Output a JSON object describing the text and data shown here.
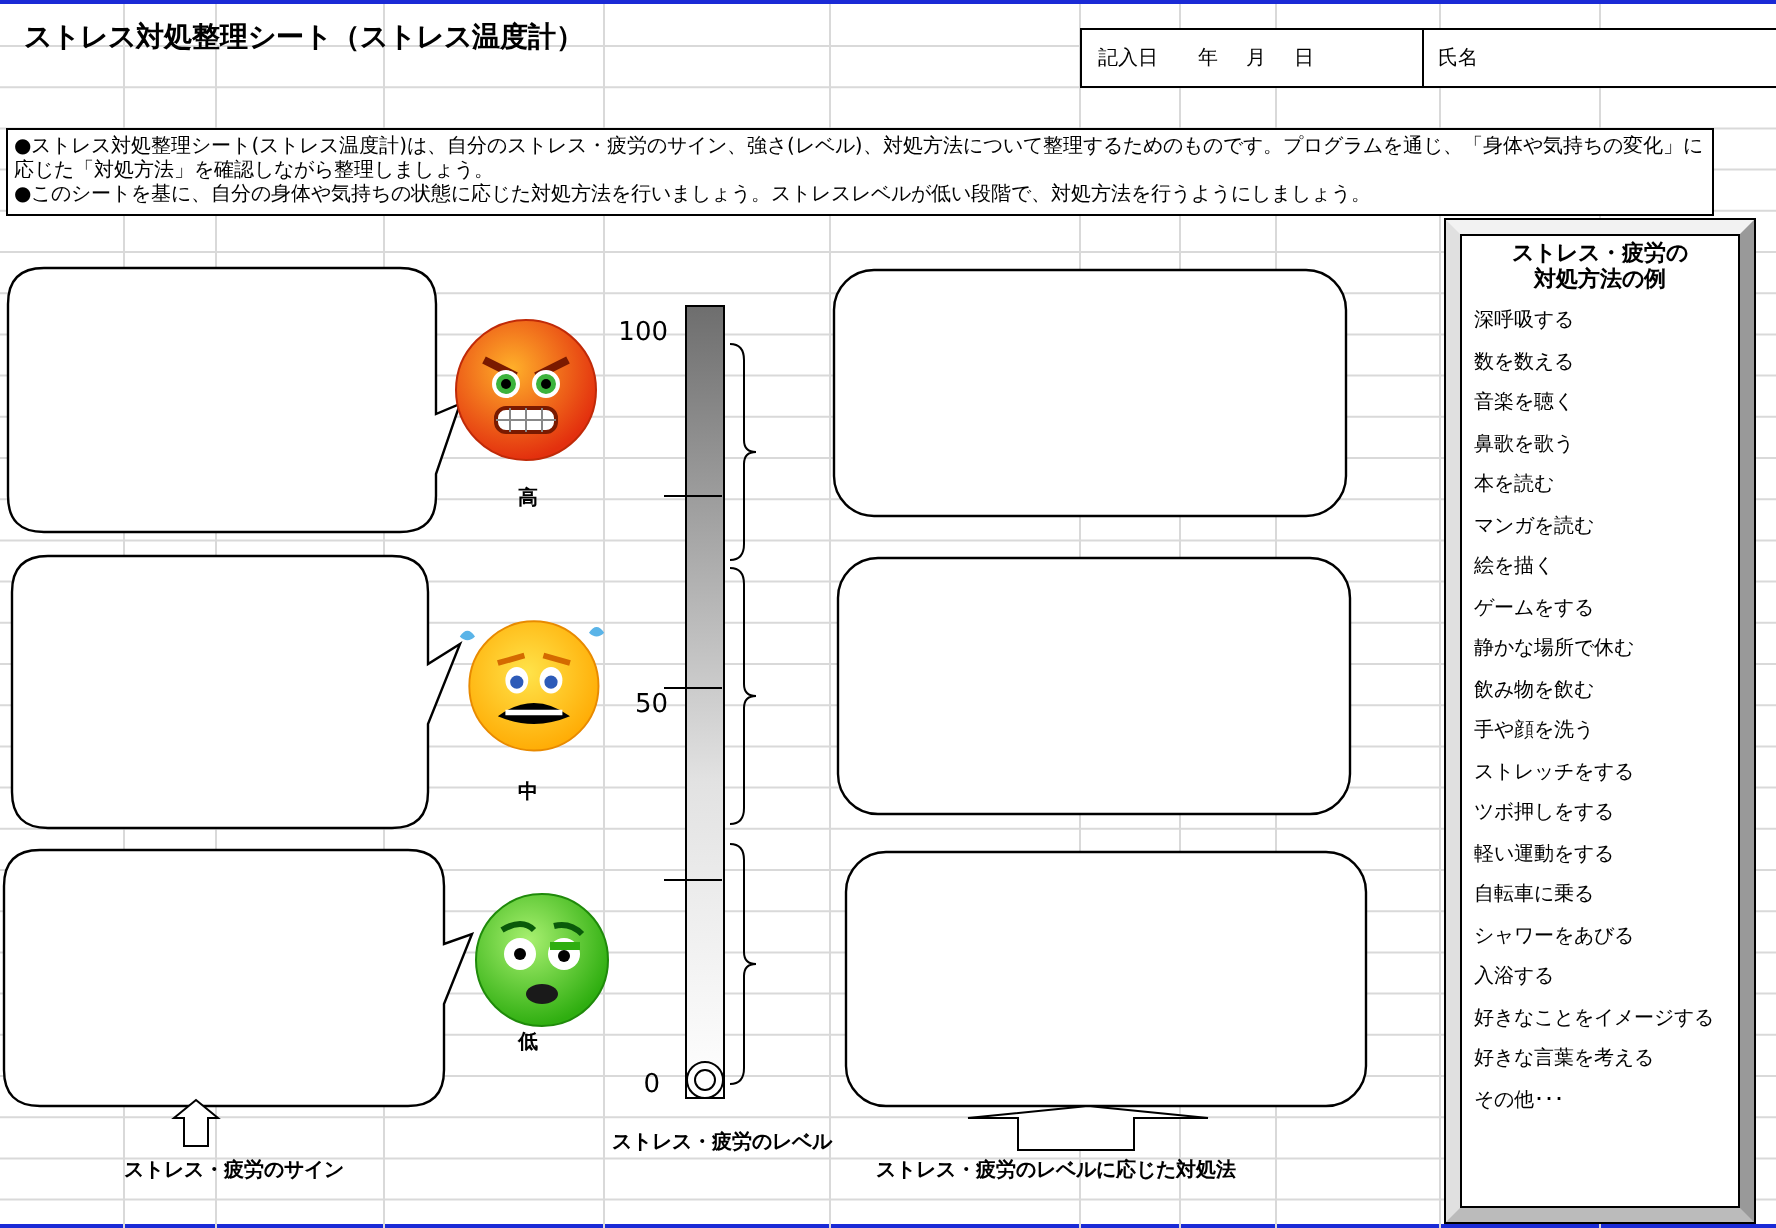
{
  "title": "ストレス対処整理シート（ストレス温度計）",
  "entry": {
    "date_label": "記入日",
    "year": "年",
    "month": "月",
    "day": "日",
    "name_label": "氏名"
  },
  "description": [
    "●ストレス対処整理シート(ストレス温度計)は、自分のストレス・疲労のサイン、強さ(レベル)、対処方法について整理するためのものです。プログラムを通じ、「身体や気持ちの変化」に応じた「対処方法」を確認しながら整理しましょう。",
    "●このシートを基に、自分の身体や気持ちの状態に応じた対処方法を行いましょう。ストレスレベルが低い段階で、対処方法を行うようにしましょう。"
  ],
  "signs": [
    {
      "kind": "angry",
      "label": "高"
    },
    {
      "kind": "scared",
      "label": "中"
    },
    {
      "kind": "sick",
      "label": "低"
    }
  ],
  "scale": [
    "100",
    "50",
    "0"
  ],
  "captions": {
    "sign": "ストレス・疲労のサイン",
    "level": "ストレス・疲労のレベル",
    "coping": "ストレス・疲労のレベルに応じた対処法"
  },
  "examples": {
    "title_lines": [
      "ストレス・疲労の",
      "対処方法の例"
    ],
    "items": [
      "深呼吸する",
      "数を数える",
      "音楽を聴く",
      "鼻歌を歌う",
      "本を読む",
      "マンガを読む",
      "絵を描く",
      "ゲームをする",
      "静かな場所で休む",
      "飲み物を飲む",
      "手や顔を洗う",
      "ストレッチをする",
      "ツボ押しをする",
      "軽い運動をする",
      "自転車に乗る",
      "シャワーをあびる",
      "入浴する",
      "好きなことをイメージする",
      "好きな言葉を考える",
      "その他･･･"
    ]
  }
}
